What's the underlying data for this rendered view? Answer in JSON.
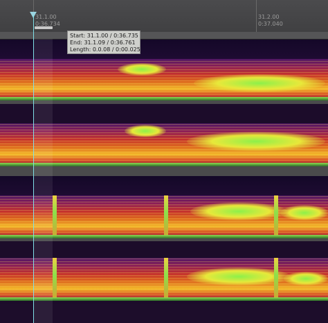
{
  "ruler": {
    "marker_1_bar": "31.1.00",
    "marker_1_time": "0:36.734",
    "marker_2_bar": "31.2.00",
    "marker_2_time": "0:37.040"
  },
  "selection_tooltip": {
    "start": "Start: 31.1.00 / 0:36.735",
    "end": "End: 31.1.09 / 0:36.761",
    "length": "Length: 0.0.08 / 0:00.025"
  },
  "colors": {
    "playhead": "#7fe0e8",
    "spectrum_low": "#4d1664",
    "spectrum_mid": "#dd6a1e",
    "spectrum_high": "#8cf04a",
    "background": "#1c0c2a"
  },
  "icons": {
    "playhead": "playhead-icon",
    "selection_marker": "selection-marker-icon"
  }
}
